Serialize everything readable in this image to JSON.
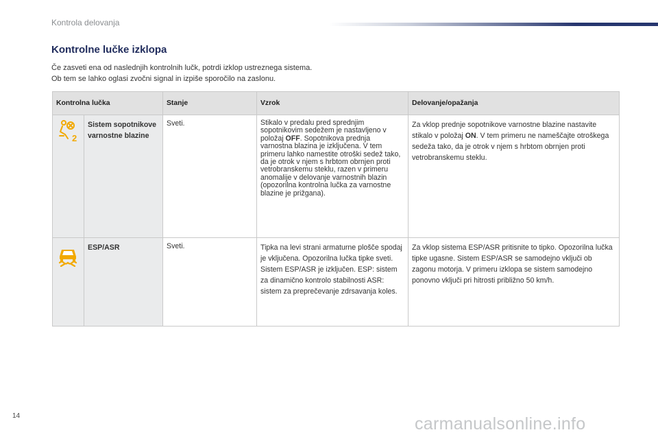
{
  "section_header": "Kontrola delovanja",
  "title": "Kontrolne lučke izklopa",
  "intro": [
    "Če zasveti ena od naslednjih kontrolnih lučk, potrdi izklop ustreznega sistema.",
    "Ob tem se lahko oglasi zvočni signal in izpiše sporočilo na zaslonu."
  ],
  "table": {
    "headers": [
      "Kontrolna lučka",
      "Stanje",
      "Vzrok",
      "Delovanje/opažanja"
    ],
    "rows": [
      {
        "icon": "passenger-airbag-off-icon",
        "name": "Sistem sopotnikove varnostne blazine",
        "state": "Sveti.",
        "cause_before": "Stikalo v predalu pred sprednjim sopotnikovim sedežem je nastavljeno v položaj ",
        "cause_bold": "OFF",
        "cause_after": ". Sopotnikova prednja varnostna blazina je izključena. V tem primeru lahko namestite otroški sedež tako, da je otrok v njem s hrbtom obrnjen proti vetrobranskemu steklu, razen v primeru anomalije v delovanje varnostnih blazin (opozorilna kontrolna lučka za varnostne blazine je prižgana).",
        "action_before": "Za vklop prednje sopotnikove varnostne blazine nastavite stikalo v položaj ",
        "action_bold": "ON",
        "action_after": ". V tem primeru ne nameščajte otroškega sedeža tako, da je otrok v njem s hrbtom obrnjen proti vetrobranskemu steklu."
      },
      {
        "icon": "esp-asr-off-icon",
        "name": "ESP/ASR",
        "state": "Sveti.",
        "cause": "Tipka na levi strani armaturne plošče spodaj je vključena. Opozorilna lučka tipke sveti. Sistem ESP/ASR je izključen. ESP: sistem za dinamično kontrolo stabilnosti ASR: sistem za preprečevanje zdrsavanja koles.",
        "action": "Za vklop sistema ESP/ASR pritisnite to tipko. Opozorilna lučka tipke ugasne. Sistem ESP/ASR se samodejno vključi ob zagonu motorja. V primeru izklopa se sistem samodejno ponovno vključi pri hitrosti približno 50 km/h."
      }
    ]
  },
  "page_number": "14",
  "watermark": "carmanualsonline.info",
  "colors": {
    "title": "#1f2b5c",
    "icon": "#f2a900",
    "header_bg": "#e1e1e1",
    "icon_column_bg": "#eaebec"
  }
}
